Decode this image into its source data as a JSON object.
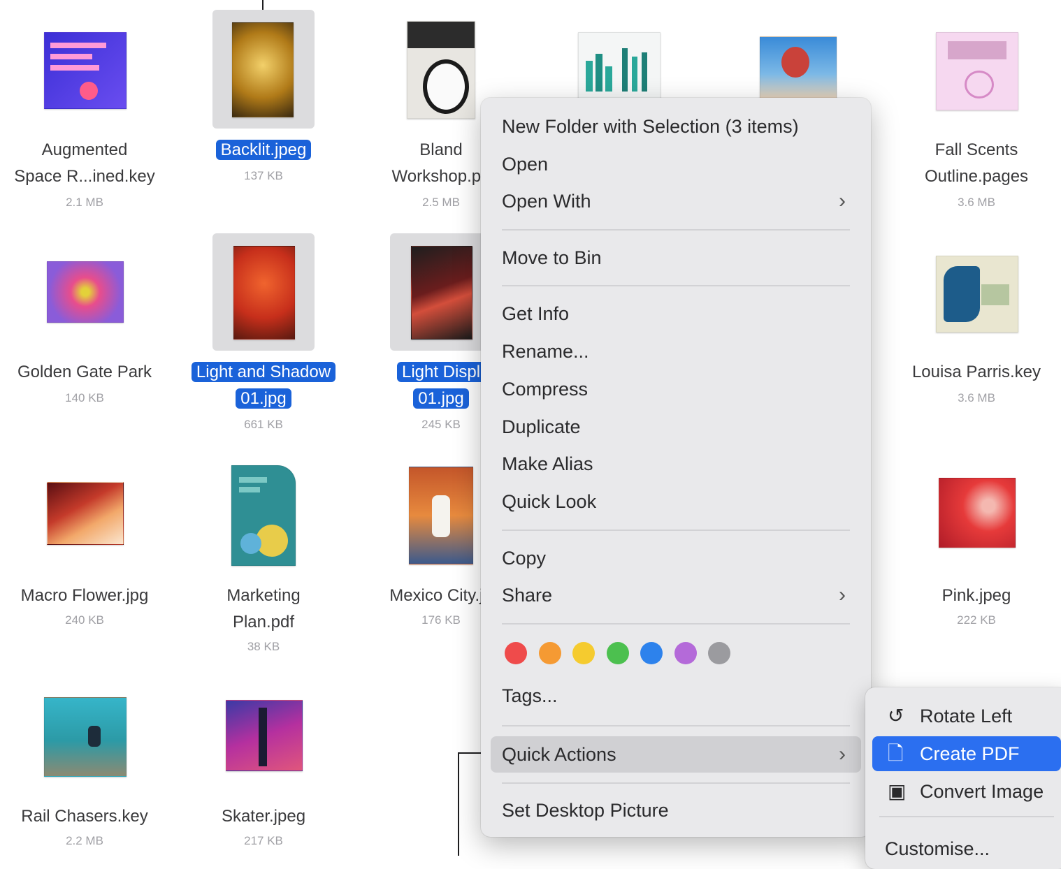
{
  "files": [
    {
      "name": "Augmented Space R...ined.key",
      "lines": [
        "Augmented",
        "Space R...ined.key"
      ],
      "size": "2.1 MB",
      "selected": false
    },
    {
      "name": "Backlit.jpeg",
      "lines": [
        "Backlit.jpeg"
      ],
      "size": "137 KB",
      "selected": true
    },
    {
      "name": "Bland Workshop.pa",
      "lines": [
        "Bland",
        "Workshop.pa"
      ],
      "size": "2.5 MB",
      "selected": false
    },
    {
      "name": "Fall Scents Outline.pages",
      "lines": [
        "Fall Scents",
        "Outline.pages"
      ],
      "size": "3.6 MB",
      "selected": false
    },
    {
      "name": "Golden Gate Park",
      "lines": [
        "Golden Gate Park"
      ],
      "size": "140 KB",
      "selected": false
    },
    {
      "name": "Light and Shadow 01.jpg",
      "lines": [
        "Light and Shadow",
        "01.jpg"
      ],
      "size": "661 KB",
      "selected": true
    },
    {
      "name": "Light Displ 01.jpg",
      "lines": [
        "Light Displ",
        "01.jpg"
      ],
      "size": "245 KB",
      "selected": true
    },
    {
      "name": "Louisa Parris.key",
      "lines": [
        "Louisa Parris.key"
      ],
      "size": "3.6 MB",
      "selected": false
    },
    {
      "name": "Macro Flower.jpg",
      "lines": [
        "Macro Flower.jpg"
      ],
      "size": "240 KB",
      "selected": false
    },
    {
      "name": "Marketing Plan.pdf",
      "lines": [
        "Marketing",
        "Plan.pdf"
      ],
      "size": "38 KB",
      "selected": false
    },
    {
      "name": "Mexico City.jpg",
      "lines": [
        "Mexico City.jp"
      ],
      "size": "176 KB",
      "selected": false
    },
    {
      "name": "Pink.jpeg",
      "lines": [
        "Pink.jpeg"
      ],
      "size": "222 KB",
      "selected": false
    },
    {
      "name": "Rail Chasers.key",
      "lines": [
        "Rail Chasers.key"
      ],
      "size": "2.2 MB",
      "selected": false
    },
    {
      "name": "Skater.jpeg",
      "lines": [
        "Skater.jpeg"
      ],
      "size": "217 KB",
      "selected": false
    }
  ],
  "context_menu": {
    "new_folder": "New Folder with Selection (3 items)",
    "open": "Open",
    "open_with": "Open With",
    "move_to_bin": "Move to Bin",
    "get_info": "Get Info",
    "rename": "Rename...",
    "compress": "Compress",
    "duplicate": "Duplicate",
    "make_alias": "Make Alias",
    "quick_look": "Quick Look",
    "copy": "Copy",
    "share": "Share",
    "tags": "Tags...",
    "quick_actions": "Quick Actions",
    "set_desktop_picture": "Set Desktop Picture",
    "tag_colors": [
      {
        "name": "red",
        "color": "#ef4b4b"
      },
      {
        "name": "orange",
        "color": "#f59a33"
      },
      {
        "name": "yellow",
        "color": "#f5cb2f"
      },
      {
        "name": "green",
        "color": "#4cc04f"
      },
      {
        "name": "blue",
        "color": "#2d82ec"
      },
      {
        "name": "purple",
        "color": "#b46ad9"
      },
      {
        "name": "gray",
        "color": "#9b9b9f"
      }
    ]
  },
  "quick_actions_menu": {
    "rotate_left": "Rotate Left",
    "create_pdf": "Create PDF",
    "convert_image": "Convert Image",
    "customise": "Customise..."
  },
  "colors": {
    "selection": "#1a62d9",
    "highlight": "#2b6ff0",
    "menu_bg": "#e9e9eb"
  }
}
